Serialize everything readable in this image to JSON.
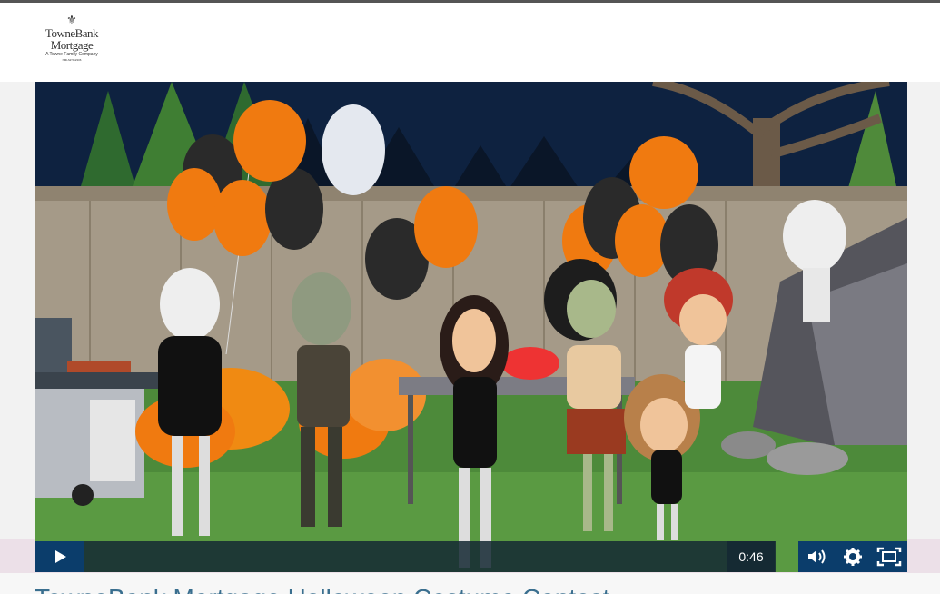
{
  "brand": {
    "line1": "TowneBank",
    "line2": "Mortgage",
    "tagline": "A Towne Family Company",
    "small": "NMLS# 512306"
  },
  "video": {
    "time": "0:46",
    "progress_fraction": 0.0
  },
  "page_title": "TowneBank Mortgage Halloween Costume Contest"
}
